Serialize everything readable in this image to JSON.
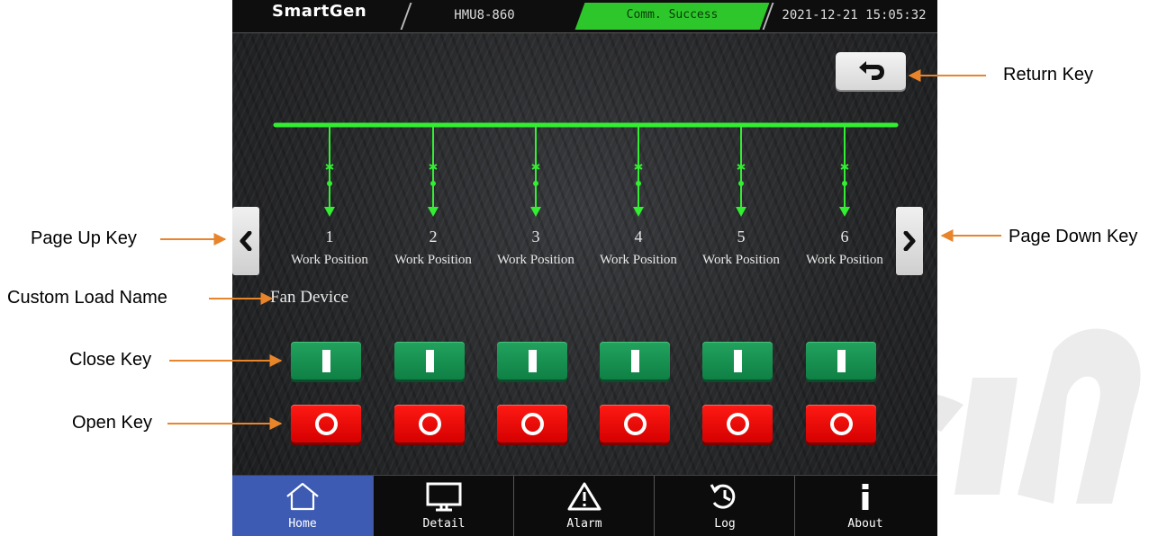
{
  "topbar": {
    "brand": "SmartGen",
    "model": "HMU8-860",
    "status": "Comm. Success",
    "datetime": "2021-12-21 15:05:32"
  },
  "load_name": "Fan Device",
  "positions": [
    {
      "number": "1",
      "label": "Work Position"
    },
    {
      "number": "2",
      "label": "Work Position"
    },
    {
      "number": "3",
      "label": "Work Position"
    },
    {
      "number": "4",
      "label": "Work Position"
    },
    {
      "number": "5",
      "label": "Work Position"
    },
    {
      "number": "6",
      "label": "Work Position"
    }
  ],
  "tabs": [
    {
      "label": "Home",
      "icon": "home-icon"
    },
    {
      "label": "Detail",
      "icon": "monitor-icon"
    },
    {
      "label": "Alarm",
      "icon": "warning-icon"
    },
    {
      "label": "Log",
      "icon": "history-icon"
    },
    {
      "label": "About",
      "icon": "info-icon"
    }
  ],
  "callouts": {
    "return_key": "Return Key",
    "page_up_key": "Page Up Key",
    "page_down_key": "Page Down Key",
    "custom_load_name": "Custom Load Name",
    "close_key": "Close Key",
    "open_key": "Open Key"
  },
  "colors": {
    "bus": "#33ee33",
    "status_bg": "#2ec72b",
    "close": "#119150",
    "open": "#ee0a05",
    "active_tab": "#3d5bb3",
    "callout_arrow": "#e8842a"
  }
}
